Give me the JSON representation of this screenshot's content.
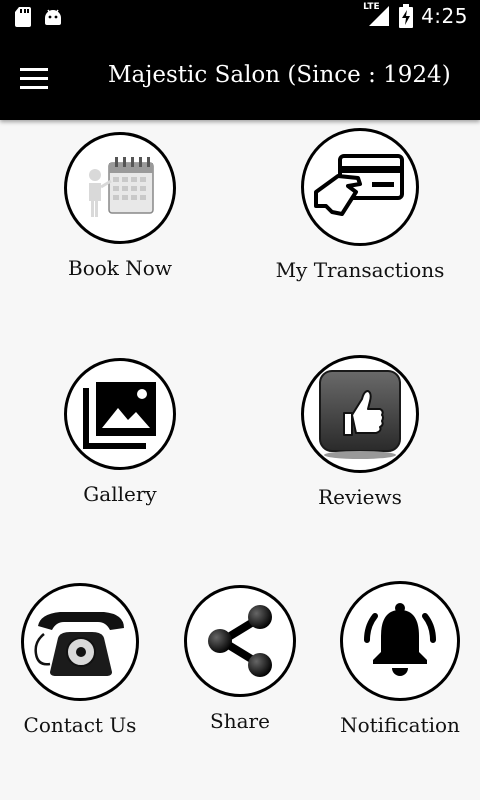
{
  "status_bar": {
    "time": "4:25",
    "network": "LTE",
    "icons": [
      "sd-card-icon",
      "android-icon",
      "signal-icon",
      "battery-charging-icon"
    ]
  },
  "app_bar": {
    "title": "Majestic Salon (Since : 1924)",
    "menu_icon": "hamburger-menu-icon"
  },
  "tiles": [
    {
      "label": "Book Now",
      "icon": "calendar-booking-icon"
    },
    {
      "label": "My Transactions",
      "icon": "credit-card-icon"
    },
    {
      "label": "Gallery",
      "icon": "gallery-icon"
    },
    {
      "label": "Reviews",
      "icon": "thumbs-up-icon"
    },
    {
      "label": "Contact Us",
      "icon": "telephone-icon"
    },
    {
      "label": "Share",
      "icon": "share-icon"
    },
    {
      "label": "Notification",
      "icon": "bell-icon"
    }
  ],
  "colors": {
    "app_bar": "#000000",
    "background": "#f7f7f7",
    "icon_border": "#000000"
  }
}
